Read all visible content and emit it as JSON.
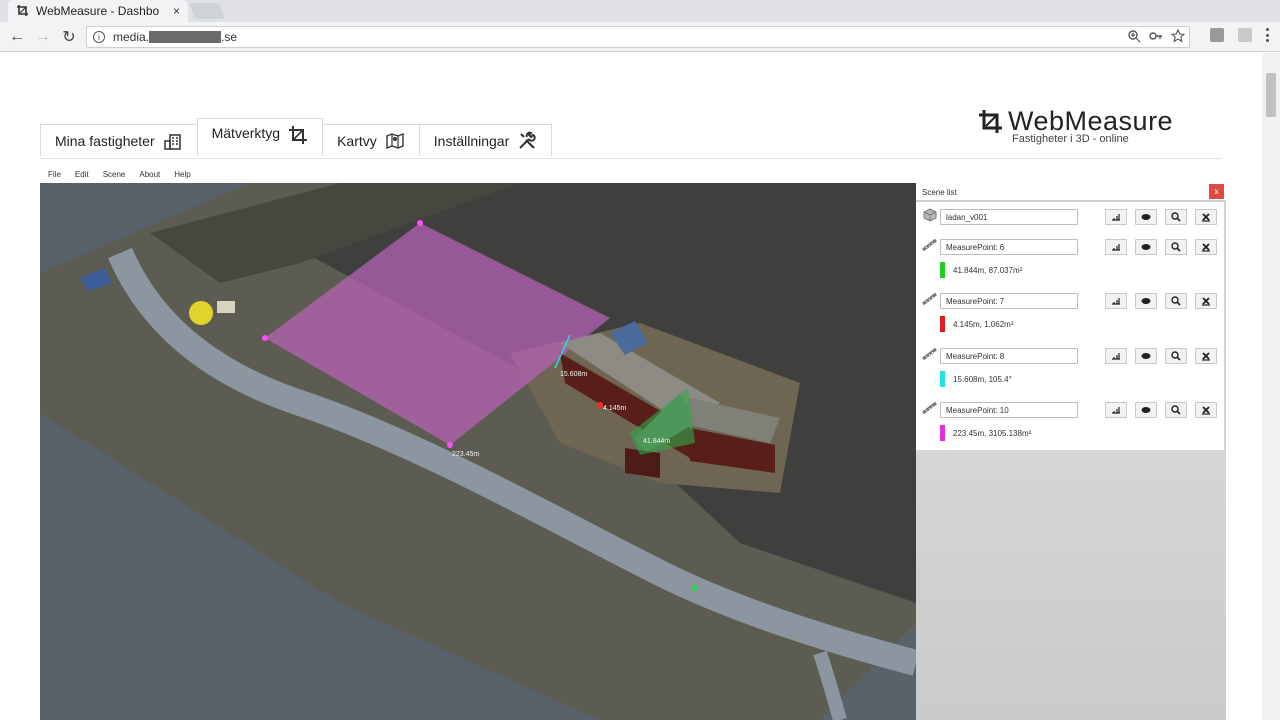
{
  "browser": {
    "tab_title": "WebMeasure - Dashbo",
    "tab_close": "×",
    "url_prefix": "media.",
    "url_suffix": ".se"
  },
  "logo": {
    "title": "WebMeasure",
    "subtitle": "Fastigheter i 3D - online"
  },
  "tabs": [
    {
      "label": "Mina fastigheter",
      "icon": "building-icon"
    },
    {
      "label": "Mätverktyg",
      "icon": "crop-icon"
    },
    {
      "label": "Kartvy",
      "icon": "map-icon"
    },
    {
      "label": "Inställningar",
      "icon": "tools-icon"
    }
  ],
  "menu": [
    "File",
    "Edit",
    "Scene",
    "About",
    "Help"
  ],
  "viewer": {
    "labels": [
      "223.45m",
      "41.844m",
      "4.145m",
      "15.608m"
    ]
  },
  "scene_list": {
    "title": "Scene list",
    "close": "x",
    "items": [
      {
        "name": "ladan_v001",
        "meta": "",
        "color": "",
        "icon": "cube-icon"
      },
      {
        "name": "MeasurePoint: 6",
        "meta": "41.844m, 87.037m²",
        "color": "#22cc22",
        "icon": "ruler-icon"
      },
      {
        "name": "MeasurePoint: 7",
        "meta": "4.145m, 1.062m²",
        "color": "#e02020",
        "icon": "ruler-icon"
      },
      {
        "name": "MeasurePoint: 8",
        "meta": "15.608m, 105.4°",
        "color": "#22e0e8",
        "icon": "ruler-icon"
      },
      {
        "name": "MeasurePoint: 10",
        "meta": "223.45m, 3105.138m²",
        "color": "#e22ee0",
        "icon": "ruler-icon"
      }
    ]
  }
}
